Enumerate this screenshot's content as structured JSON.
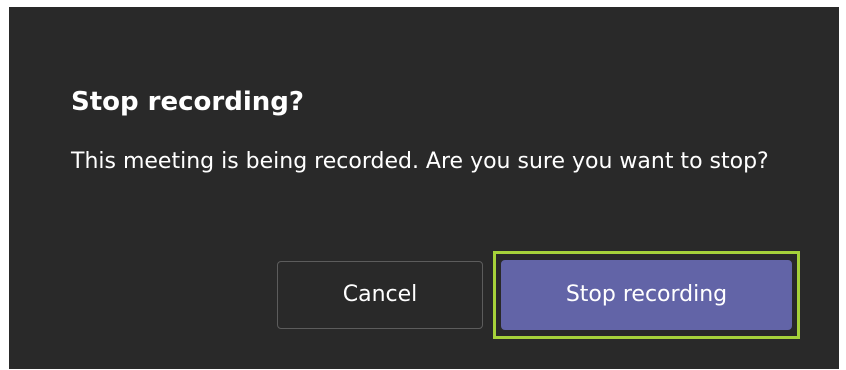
{
  "dialog": {
    "title": "Stop recording?",
    "message": "This meeting is being recorded. Are you sure you want to stop?",
    "cancel_label": "Cancel",
    "confirm_label": "Stop recording"
  },
  "colors": {
    "dialog_background": "#292929",
    "primary_button": "#6264a7",
    "focus_outline": "#a6d23a",
    "text": "#ffffff"
  }
}
